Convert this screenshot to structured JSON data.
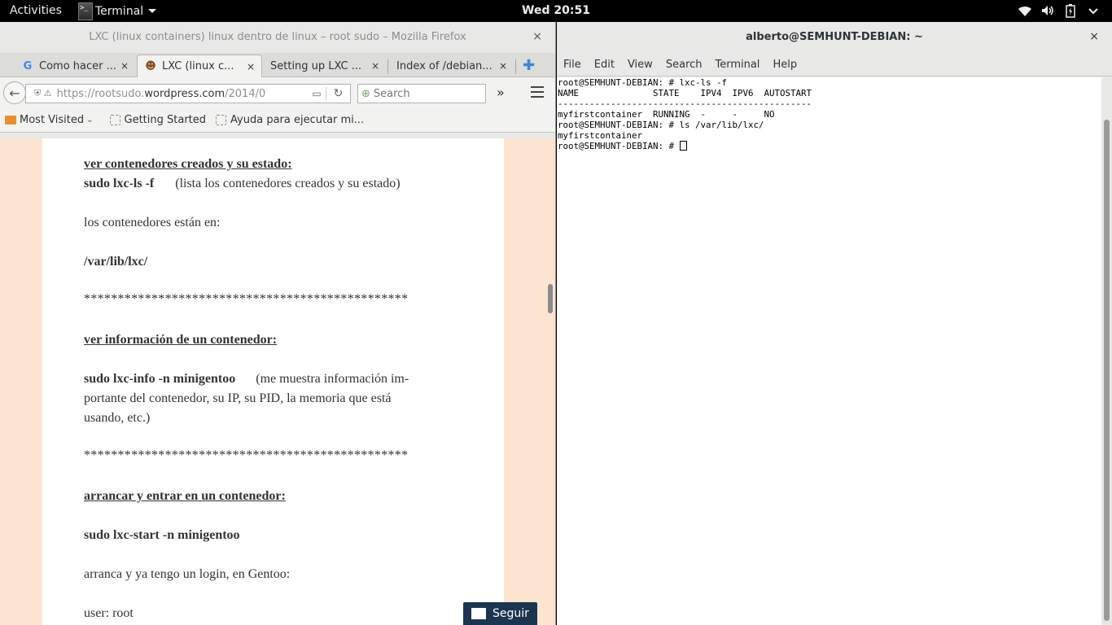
{
  "topbar": {
    "activities": "Activities",
    "app_name": "Terminal",
    "clock": "Wed 20:51",
    "term_icon_glyph": ">_"
  },
  "firefox": {
    "window_title": "LXC (linux containers) linux dentro de linux – root sudo – Mozilla Firefox",
    "close": "×",
    "tabs": [
      {
        "label": "Como hacer ...",
        "favicon": "google-icon",
        "fav_glyph": "G",
        "close": "×"
      },
      {
        "label": "LXC (linux c...",
        "favicon": "site-icon",
        "fav_glyph": "☻",
        "close": "×"
      },
      {
        "label": "Setting up LXC ...",
        "favicon": "none",
        "fav_glyph": "",
        "close": "×"
      },
      {
        "label": "Index of /debian...",
        "favicon": "none",
        "fav_glyph": "",
        "close": "×"
      }
    ],
    "new_tab": "✚",
    "url_prefix": "https://rootsudo.",
    "url_domain": "wordpress.com",
    "url_suffix": "/2014/0",
    "search_placeholder": "Search",
    "overflow": "»",
    "bookmarks": [
      {
        "label": "Most Visited",
        "dropdown": "⌄"
      },
      {
        "label": "Getting Started"
      },
      {
        "label": "Ayuda para ejecutar mi..."
      }
    ],
    "article": {
      "h1": "ver contenedores creados y su estado:",
      "cmd1": "sudo lxc-ls -f",
      "cmd1_desc": "(lista los contenedores creados y su estado)",
      "text1": "los contenedores están en:",
      "path": "/var/lib/lxc/",
      "stars": "************************************************",
      "h2": "ver información de un contenedor:",
      "cmd2": "sudo lxc-info -n minigentoo",
      "cmd2_desc": "(me muestra información im-",
      "cmd2_desc2": "portante del contenedor, su IP, su PID, la memoria que está",
      "cmd2_desc3": "usando, etc.)",
      "h3": "arrancar y entrar en un contenedor:",
      "cmd3": "sudo lxc-start -n minigentoo",
      "text2": "arranca y ya tengo un login, en Gentoo:",
      "text3": "user: root"
    },
    "follow_button": "Seguir"
  },
  "terminal": {
    "window_title": "alberto@SEMHUNT-DEBIAN: ~",
    "close": "×",
    "menu": [
      "File",
      "Edit",
      "View",
      "Search",
      "Terminal",
      "Help"
    ],
    "lines": [
      "root@SEMHUNT-DEBIAN: # lxc-ls -f",
      "NAME              STATE    IPV4  IPV6  AUTOSTART",
      "------------------------------------------------",
      "myfirstcontainer  RUNNING  -     -     NO",
      "root@SEMHUNT-DEBIAN: # ls /var/lib/lxc/",
      "myfirstcontainer"
    ],
    "prompt": "root@SEMHUNT-DEBIAN: # "
  }
}
